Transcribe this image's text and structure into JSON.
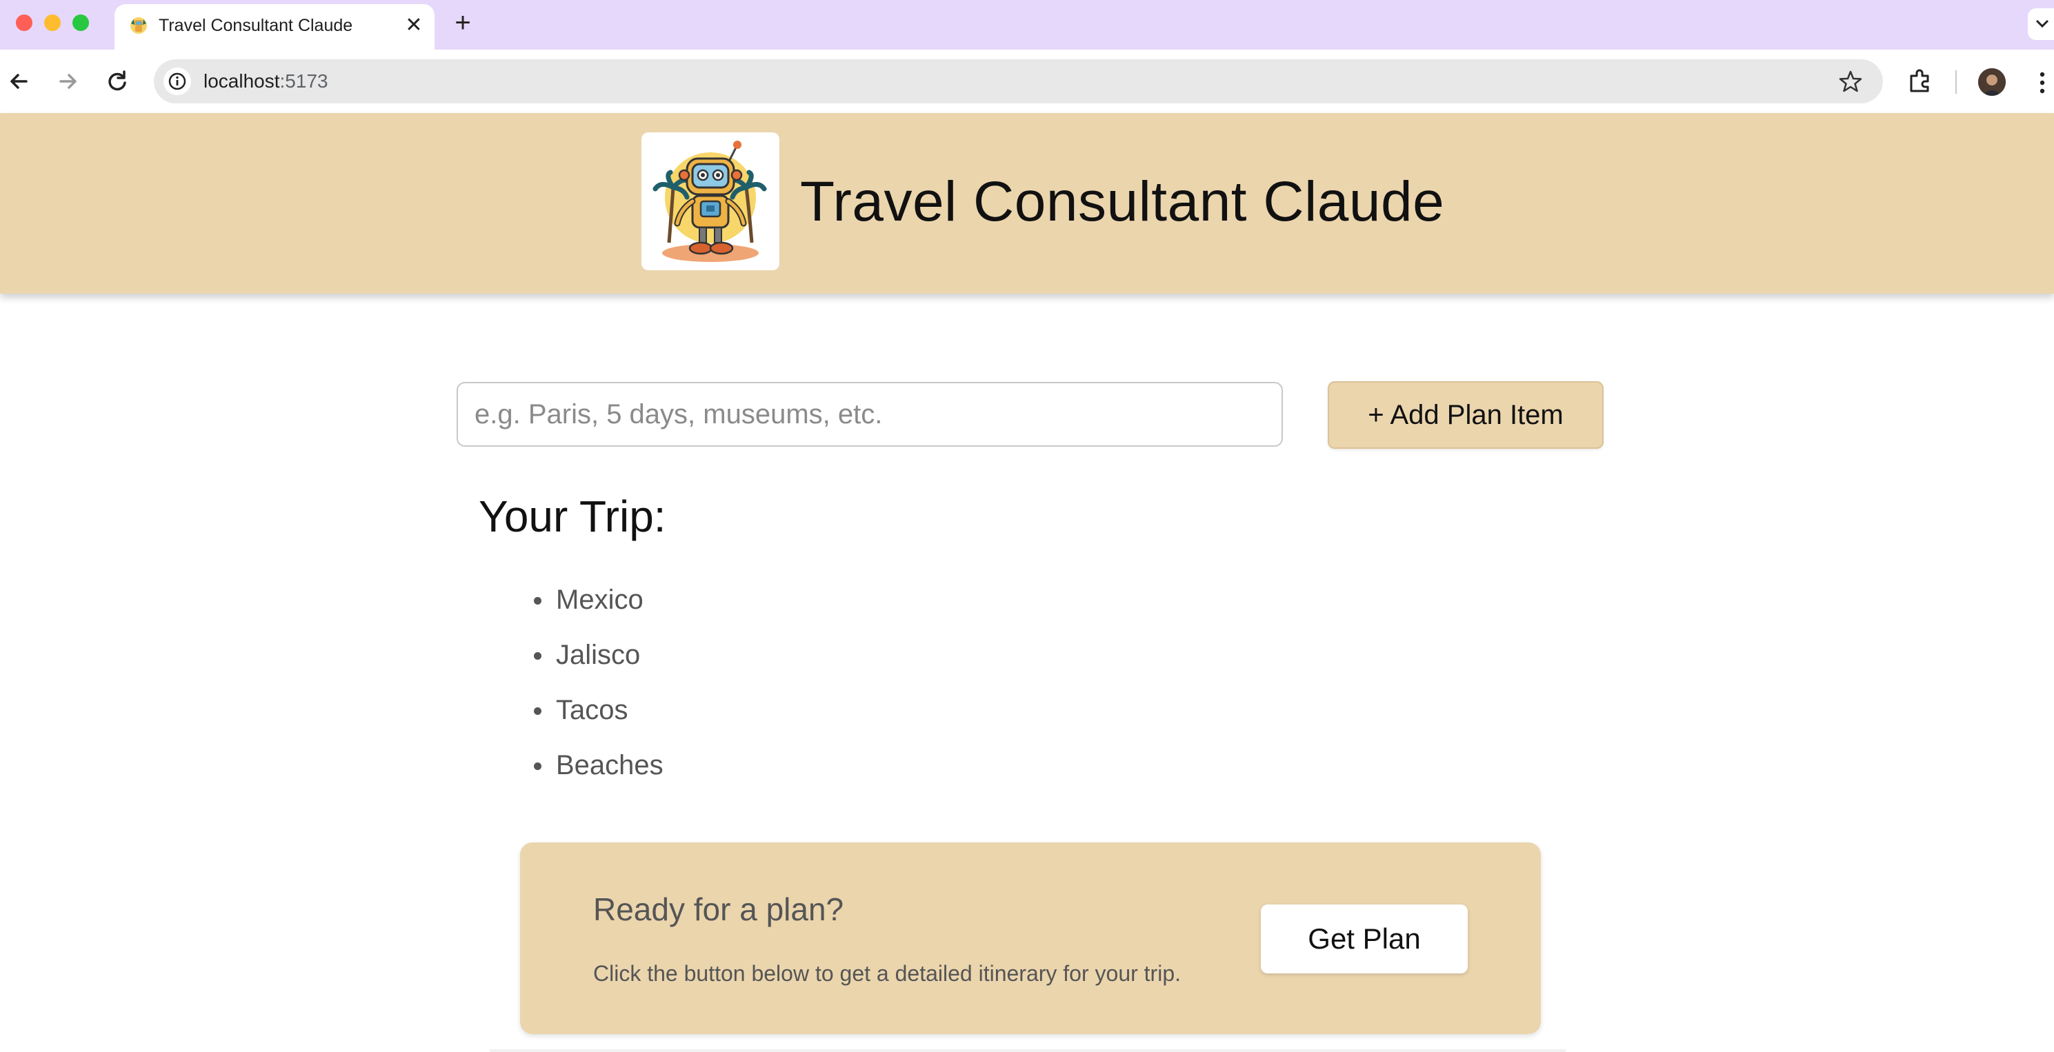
{
  "browser": {
    "tab": {
      "title": "Travel Consultant Claude"
    },
    "address": {
      "host": "localhost",
      "port": ":5173"
    }
  },
  "header": {
    "title": "Travel Consultant Claude"
  },
  "planner": {
    "input_placeholder": "e.g. Paris, 5 days, museums, etc.",
    "add_button_label": "+ Add Plan Item"
  },
  "trip": {
    "heading": "Your Trip:",
    "items": [
      "Mexico",
      "Jalisco",
      "Tacos",
      "Beaches"
    ]
  },
  "plan_card": {
    "title": "Ready for a plan?",
    "description": "Click the button below to get a detailed itinerary for your trip.",
    "button_label": "Get Plan"
  },
  "colors": {
    "tab_strip": "#e6d8fa",
    "header_bg": "#ebd5ad",
    "accent_button": "#ebd5ad"
  }
}
